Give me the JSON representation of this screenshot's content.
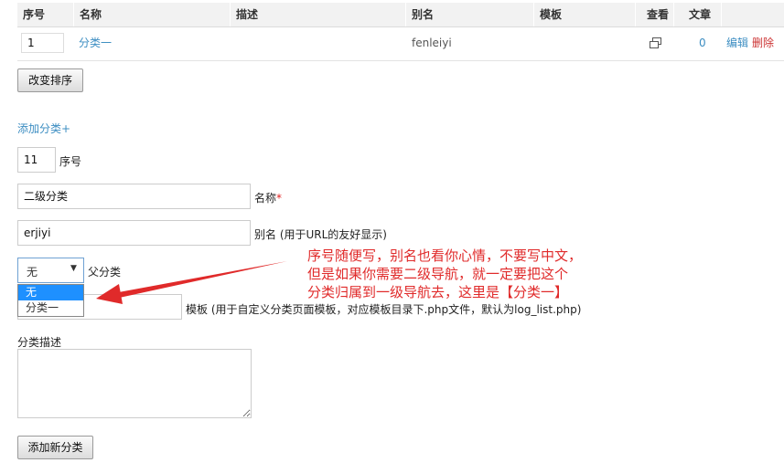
{
  "table": {
    "headers": [
      "序号",
      "名称",
      "描述",
      "别名",
      "模板",
      "查看",
      "文章"
    ],
    "row": {
      "order": "1",
      "name": "分类一",
      "description": "",
      "alias": "fenleiyi",
      "template": "",
      "view_icon": "window-icon",
      "count": "0",
      "edit": "编辑",
      "delete": "删除"
    }
  },
  "change_order_button": "改变排序",
  "add_category_link": "添加分类+",
  "form": {
    "order_value": "11",
    "order_label": "序号",
    "name_value": "二级分类",
    "name_label": "名称",
    "required_mark": "*",
    "alias_value": "erjiyi",
    "alias_label": "别名 (用于URL的友好显示)",
    "parent_selected": "无",
    "parent_label": "父分类",
    "parent_options": [
      "无",
      "分类一"
    ],
    "template_label": "模板 (用于自定义分类页面模板，对应模板目录下.php文件，默认为log_list.php)",
    "desc_label": "分类描述",
    "submit_button": "添加新分类"
  },
  "annotation": {
    "line1": "序号随便写，别名也看你心情，不要写中文，",
    "line2": "但是如果你需要二级导航，就一定要把这个",
    "line3": "分类归属到一级导航去，这里是【分类一】"
  },
  "colors": {
    "link": "#3d8ec2",
    "delete": "#cc3333",
    "annotation": "#e02a2a",
    "selected_option": "#1e90ff"
  }
}
